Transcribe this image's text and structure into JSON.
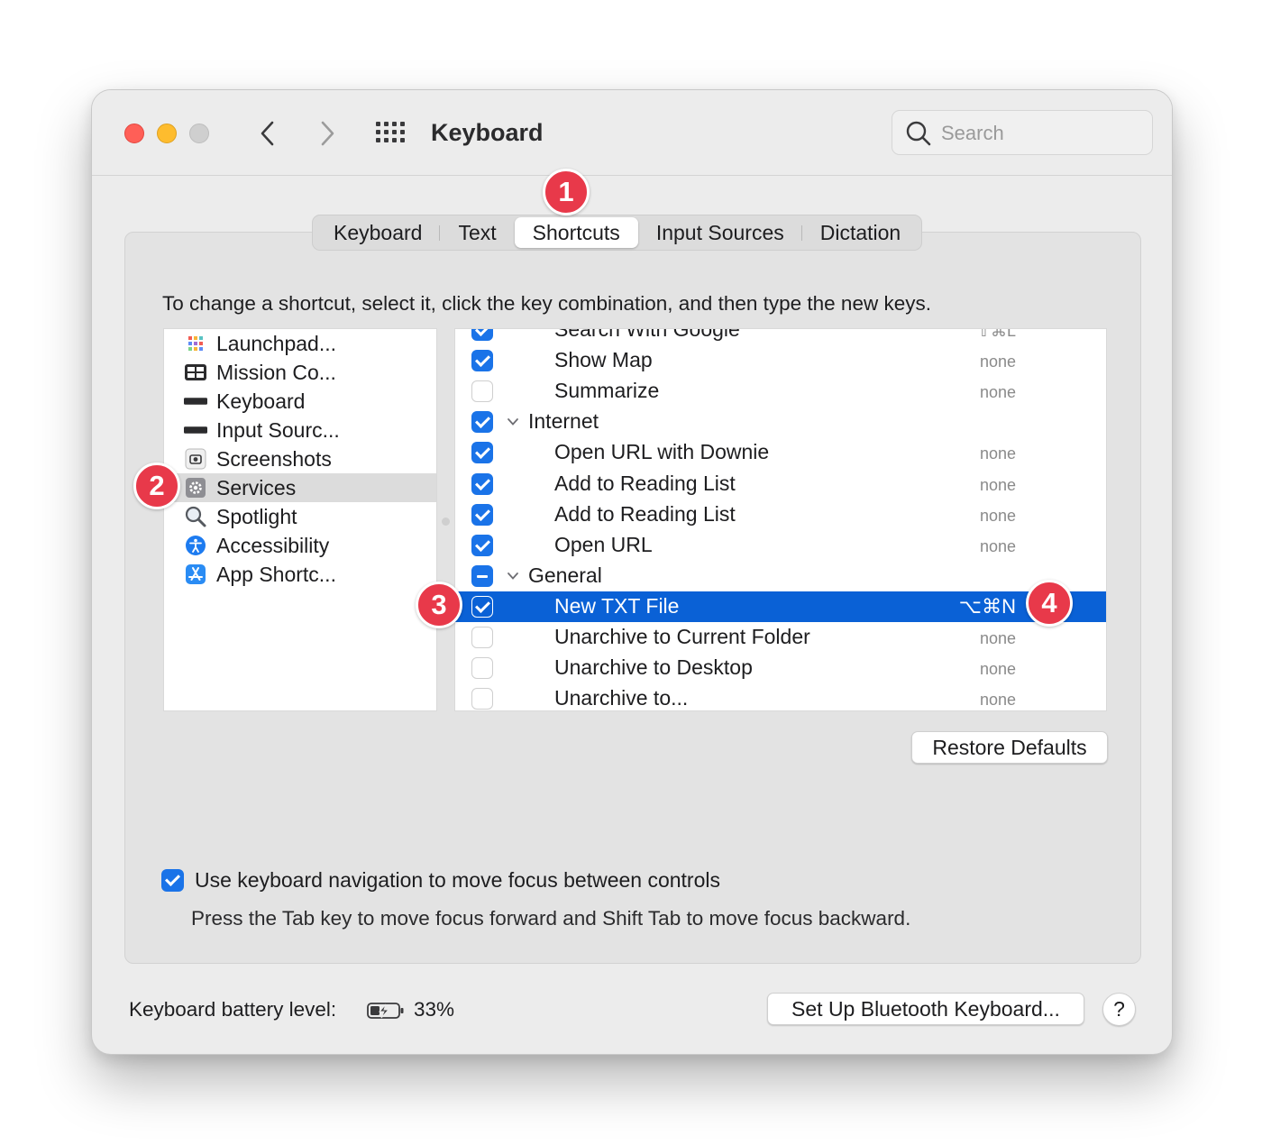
{
  "window": {
    "title": "Keyboard",
    "search_placeholder": "Search"
  },
  "tabs": [
    {
      "label": "Keyboard",
      "active": false
    },
    {
      "label": "Text",
      "active": false
    },
    {
      "label": "Shortcuts",
      "active": true
    },
    {
      "label": "Input Sources",
      "active": false
    },
    {
      "label": "Dictation",
      "active": false
    }
  ],
  "instruction": "To change a shortcut, select it, click the key combination, and then type the new keys.",
  "categories": [
    {
      "label": "Launchpad...",
      "icon": "launchpad-icon",
      "selected": false
    },
    {
      "label": "Mission Co...",
      "icon": "mission-control-icon",
      "selected": false
    },
    {
      "label": "Keyboard",
      "icon": "keyboard-icon",
      "selected": false
    },
    {
      "label": "Input Sourc...",
      "icon": "input-sources-icon",
      "selected": false
    },
    {
      "label": "Screenshots",
      "icon": "screenshot-icon",
      "selected": false
    },
    {
      "label": "Services",
      "icon": "gear-icon",
      "selected": true
    },
    {
      "label": "Spotlight",
      "icon": "magnifier-icon",
      "selected": false
    },
    {
      "label": "Accessibility",
      "icon": "accessibility-icon",
      "selected": false
    },
    {
      "label": "App Shortc...",
      "icon": "app-store-icon",
      "selected": false
    }
  ],
  "shortcuts": [
    {
      "label": "Search With Google",
      "key": "⇧⌘L",
      "checked": "on",
      "type": "item",
      "partial": true
    },
    {
      "label": "Show Map",
      "key": "none",
      "checked": "on",
      "type": "item"
    },
    {
      "label": "Summarize",
      "key": "none",
      "checked": "off",
      "type": "item"
    },
    {
      "label": "Internet",
      "key": "",
      "checked": "on",
      "type": "group"
    },
    {
      "label": "Open URL with Downie",
      "key": "none",
      "checked": "on",
      "type": "item"
    },
    {
      "label": "Add to Reading List",
      "key": "none",
      "checked": "on",
      "type": "item"
    },
    {
      "label": "Add to Reading List",
      "key": "none",
      "checked": "on",
      "type": "item"
    },
    {
      "label": "Open URL",
      "key": "none",
      "checked": "on",
      "type": "item"
    },
    {
      "label": "General",
      "key": "",
      "checked": "mixed",
      "type": "group"
    },
    {
      "label": "New TXT File",
      "key": "⌥⌘N",
      "checked": "on",
      "type": "item",
      "highlight": true
    },
    {
      "label": "Unarchive to Current Folder",
      "key": "none",
      "checked": "off",
      "type": "item"
    },
    {
      "label": "Unarchive to Desktop",
      "key": "none",
      "checked": "off",
      "type": "item"
    },
    {
      "label": "Unarchive to...",
      "key": "none",
      "checked": "off",
      "type": "item"
    }
  ],
  "restore_defaults": "Restore Defaults",
  "keyboard_navigation": {
    "checked": true,
    "label": "Use keyboard navigation to move focus between controls",
    "hint": "Press the Tab key to move focus forward and Shift Tab to move focus backward."
  },
  "battery": {
    "label": "Keyboard battery level:",
    "value": "33%"
  },
  "bluetooth_button": "Set Up Bluetooth Keyboard...",
  "help_button": "?",
  "markers": [
    "1",
    "2",
    "3",
    "4"
  ],
  "colors": {
    "accent": "#1a73e8",
    "selection": "#0a61d6",
    "marker": "#e8394a"
  }
}
